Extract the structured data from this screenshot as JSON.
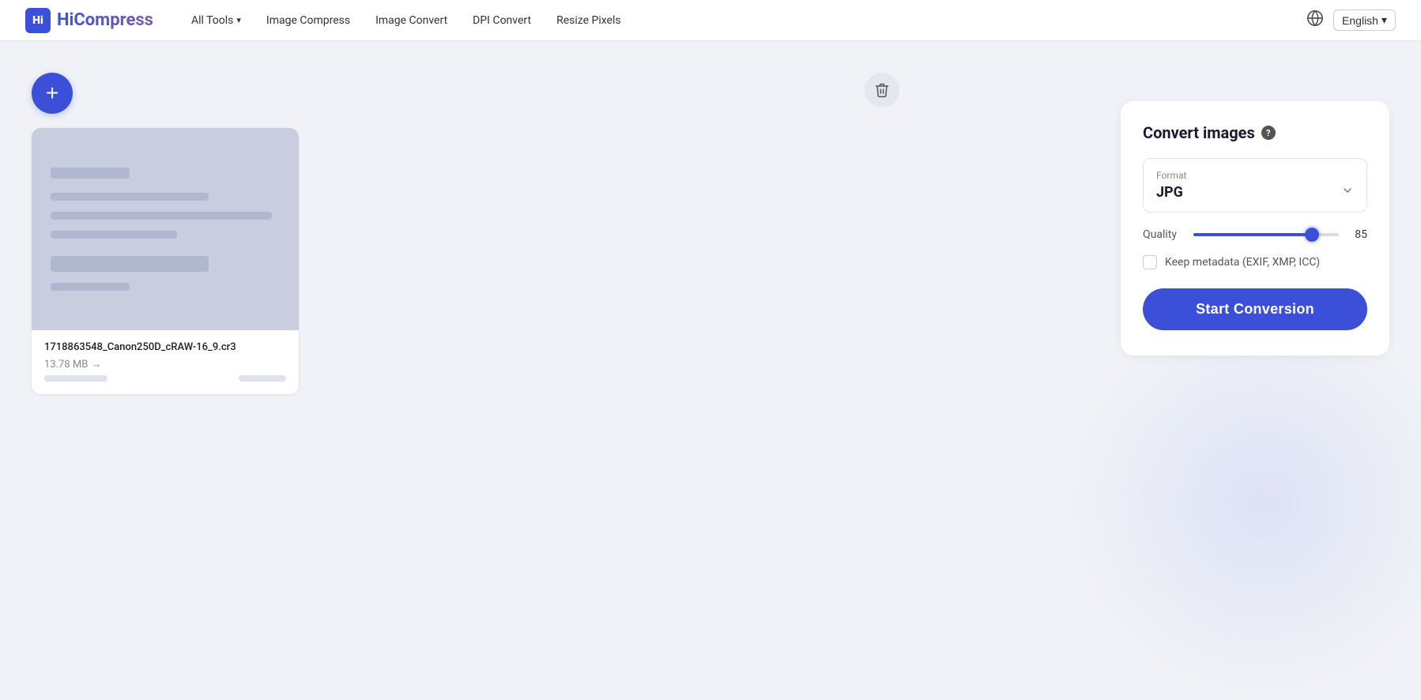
{
  "navbar": {
    "logo_text": "HiCompress",
    "logo_abbr": "Hi",
    "nav_links": [
      {
        "id": "all-tools",
        "label": "All Tools",
        "has_chevron": true
      },
      {
        "id": "image-compress",
        "label": "Image Compress"
      },
      {
        "id": "image-convert",
        "label": "Image Convert"
      },
      {
        "id": "dpi-convert",
        "label": "DPI Convert"
      },
      {
        "id": "resize-pixels",
        "label": "Resize Pixels"
      }
    ],
    "language_label": "English",
    "language_chevron": "▾"
  },
  "add_button_label": "+",
  "file_card": {
    "filename": "1718863548_Canon250D_cRAW-16_9.cr3",
    "filesize": "13.78 MB",
    "arrow": "→"
  },
  "sidebar": {
    "title": "Convert images",
    "help_icon": "?",
    "format_section": {
      "label": "Format",
      "value": "JPG"
    },
    "quality_section": {
      "label": "Quality",
      "value": 85,
      "min": 0,
      "max": 100
    },
    "metadata_checkbox": {
      "label": "Keep metadata (EXIF, XMP, ICC)",
      "checked": false
    },
    "start_button_label": "Start Conversion"
  },
  "icons": {
    "delete_icon": "🗑",
    "chevron_down": "❯",
    "globe": "🌐"
  }
}
